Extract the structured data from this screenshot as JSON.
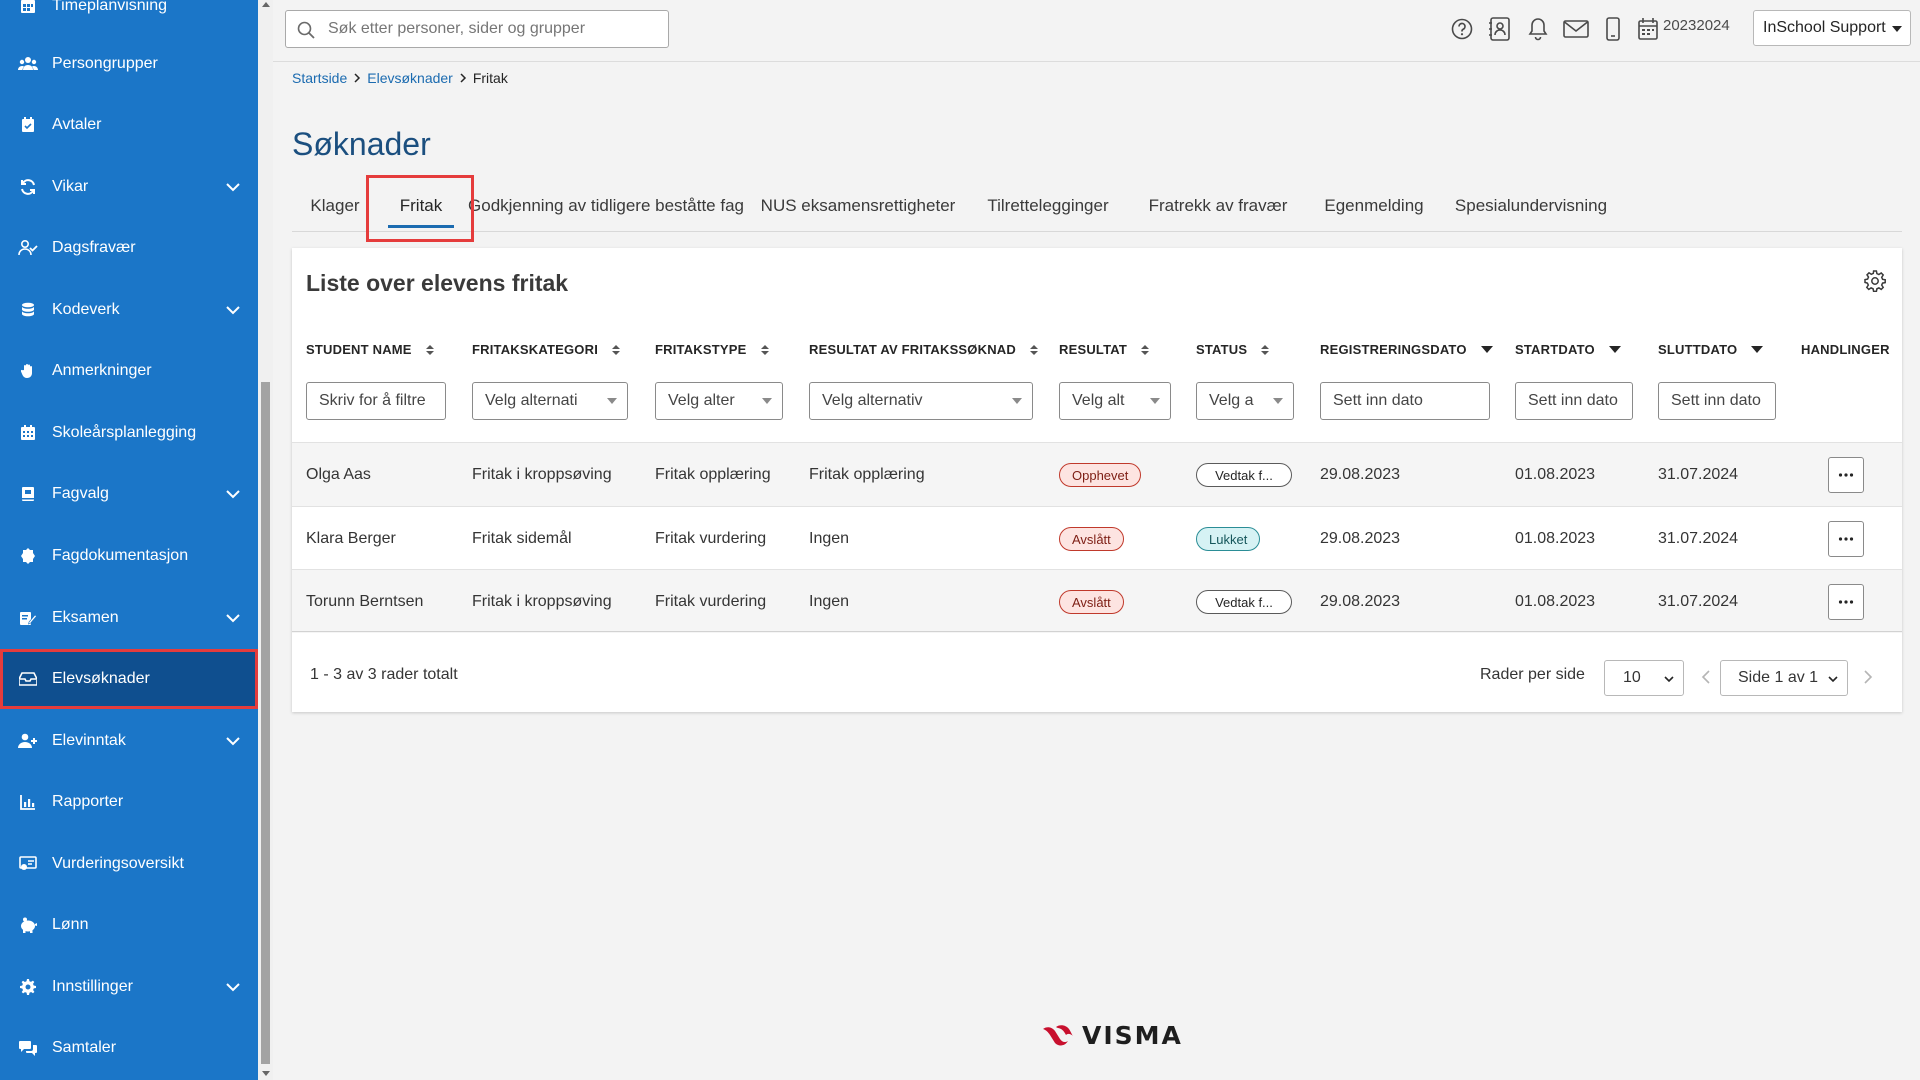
{
  "sidebar": {
    "items": [
      {
        "label": "Timeplanvisning",
        "icon": "calendar-grid-icon",
        "expandable": false
      },
      {
        "label": "Persongrupper",
        "icon": "people-group-icon",
        "expandable": false
      },
      {
        "label": "Avtaler",
        "icon": "calendar-check-icon",
        "expandable": false
      },
      {
        "label": "Vikar",
        "icon": "swap-icon",
        "expandable": true
      },
      {
        "label": "Dagsfravær",
        "icon": "user-check-icon",
        "expandable": false
      },
      {
        "label": "Kodeverk",
        "icon": "database-icon",
        "expandable": true
      },
      {
        "label": "Anmerkninger",
        "icon": "hand-icon",
        "expandable": false
      },
      {
        "label": "Skoleårsplanlegging",
        "icon": "calendar-icon",
        "expandable": false
      },
      {
        "label": "Fagvalg",
        "icon": "book-icon",
        "expandable": true
      },
      {
        "label": "Fagdokumentasjon",
        "icon": "badge-icon",
        "expandable": false
      },
      {
        "label": "Eksamen",
        "icon": "pencil-paper-icon",
        "expandable": true
      },
      {
        "label": "Elevsøknader",
        "icon": "inbox-icon",
        "expandable": false,
        "active": true
      },
      {
        "label": "Elevinntak",
        "icon": "user-plus-icon",
        "expandable": true
      },
      {
        "label": "Rapporter",
        "icon": "bar-chart-icon",
        "expandable": false
      },
      {
        "label": "Vurderingsoversikt",
        "icon": "assessment-icon",
        "expandable": false
      },
      {
        "label": "Lønn",
        "icon": "piggy-bank-icon",
        "expandable": false
      },
      {
        "label": "Innstillinger",
        "icon": "gear-icon",
        "expandable": true
      },
      {
        "label": "Samtaler",
        "icon": "chat-icon",
        "expandable": false
      }
    ]
  },
  "header": {
    "search_placeholder": "Søk etter personer, sider og grupper",
    "school_year": "20232024",
    "user_label": "InSchool Support"
  },
  "breadcrumb": {
    "items": [
      "Startside",
      "Elevsøknader"
    ],
    "current": "Fritak"
  },
  "page": {
    "title": "Søknader",
    "tabs": [
      {
        "label": "Klager",
        "active": false
      },
      {
        "label": "Fritak",
        "active": true
      },
      {
        "label": "Godkjenning av tidligere beståtte fag",
        "active": false
      },
      {
        "label": "NUS eksamensrettigheter",
        "active": false
      },
      {
        "label": "Tilrettelegginger",
        "active": false
      },
      {
        "label": "Fratrekk av fravær",
        "active": false
      },
      {
        "label": "Egenmelding",
        "active": false
      },
      {
        "label": "Spesialundervisning",
        "active": false
      }
    ]
  },
  "table": {
    "title": "Liste over elevens fritak",
    "columns": [
      {
        "label": "STUDENT NAME",
        "sort": "both"
      },
      {
        "label": "FRITAKSKATEGORI",
        "sort": "both"
      },
      {
        "label": "FRITAKSTYPE",
        "sort": "both"
      },
      {
        "label": "RESULTAT AV FRITAKSSØKNAD",
        "sort": "both"
      },
      {
        "label": "RESULTAT",
        "sort": "both"
      },
      {
        "label": "STATUS",
        "sort": "both"
      },
      {
        "label": "REGISTRERINGSDATO",
        "sort": "desc"
      },
      {
        "label": "STARTDATO",
        "sort": "desc"
      },
      {
        "label": "SLUTTDATO",
        "sort": "desc"
      },
      {
        "label": "HANDLINGER",
        "sort": "none"
      }
    ],
    "filters": [
      "Skriv for å filtre",
      "Velg alternati",
      "Velg alter",
      "Velg alternativ",
      "Velg alt",
      "Velg a",
      "Sett inn dato",
      "Sett inn dato",
      "Sett inn dato"
    ],
    "rows": [
      {
        "student": "Olga Aas",
        "kategori": "Fritak i kroppsøving",
        "type": "Fritak opplæring",
        "resultat_soknad": "Fritak opplæring",
        "resultat": "Opphevet",
        "status": "Vedtak f...",
        "registrert": "29.08.2023",
        "start": "01.08.2023",
        "slutt": "31.07.2024"
      },
      {
        "student": "Klara Berger",
        "kategori": "Fritak sidemål",
        "type": "Fritak vurdering",
        "resultat_soknad": "Ingen",
        "resultat": "Avslått",
        "status": "Lukket",
        "registrert": "29.08.2023",
        "start": "01.08.2023",
        "slutt": "31.07.2024"
      },
      {
        "student": "Torunn Berntsen",
        "kategori": "Fritak i kroppsøving",
        "type": "Fritak vurdering",
        "resultat_soknad": "Ingen",
        "resultat": "Avslått",
        "status": "Vedtak f...",
        "registrert": "29.08.2023",
        "start": "01.08.2023",
        "slutt": "31.07.2024"
      }
    ],
    "row_count": "1 - 3 av 3 rader totalt",
    "rows_per_page_label": "Rader per side",
    "rows_per_page": "10",
    "page_label": "Side 1 av 1"
  },
  "footer": {
    "logo_text": "VISMA"
  },
  "colors": {
    "sidebar_bg": "#1b76c8",
    "sidebar_active": "#0f4f8f",
    "highlight": "#e53c3c",
    "link": "#1b6bb0",
    "title": "#1b4f7f"
  }
}
